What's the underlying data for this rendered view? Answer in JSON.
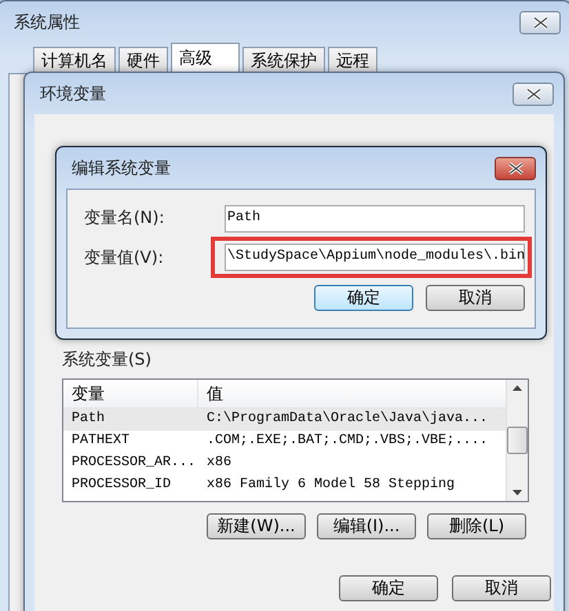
{
  "outer_window": {
    "title": "系统属性",
    "tabs": [
      {
        "label": "计算机名",
        "selected": false
      },
      {
        "label": "硬件",
        "selected": false
      },
      {
        "label": "高级",
        "selected": true
      },
      {
        "label": "系统保护",
        "selected": false
      },
      {
        "label": "远程",
        "selected": false
      }
    ]
  },
  "env_window": {
    "title": "环境变量",
    "system_vars_label": "系统变量(S)",
    "columns": [
      "变量",
      "值"
    ],
    "rows": [
      {
        "name": "Path",
        "value": "C:\\ProgramData\\Oracle\\Java\\java...",
        "selected": true
      },
      {
        "name": "PATHEXT",
        "value": ".COM;.EXE;.BAT;.CMD;.VBS;.VBE;....",
        "selected": false
      },
      {
        "name": "PROCESSOR_AR...",
        "value": "x86",
        "selected": false
      },
      {
        "name": "PROCESSOR_ID",
        "value": "x86 Family 6 Model 58 Stepping",
        "selected": false
      }
    ],
    "list_buttons": [
      "新建(W)...",
      "编辑(I)...",
      "删除(L)"
    ],
    "buttons": [
      "确定",
      "取消"
    ]
  },
  "edit_dialog": {
    "title": "编辑系统变量",
    "name_label": "变量名(N):",
    "name_value": "Path",
    "value_label": "变量值(V):",
    "value_value": "\\StudySpace\\Appium\\node_modules\\.bin",
    "value_highlighted": true,
    "buttons": [
      {
        "label": "确定",
        "default": true
      },
      {
        "label": "取消",
        "default": false
      }
    ]
  }
}
